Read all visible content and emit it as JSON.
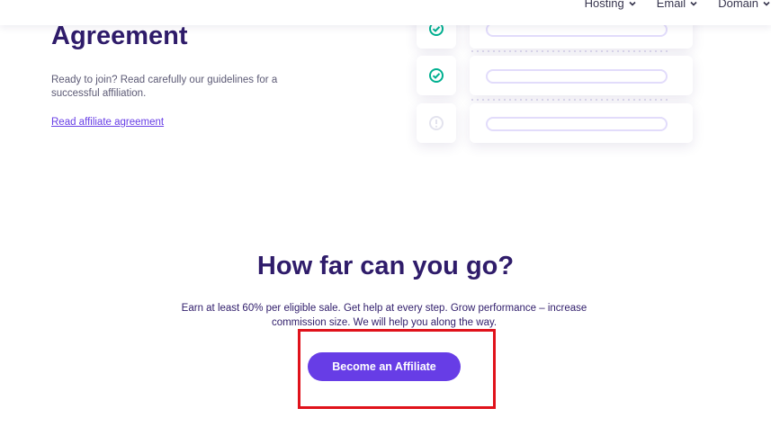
{
  "nav": {
    "items": [
      {
        "label": "Hosting",
        "icon": "chevron-down-icon"
      },
      {
        "label": "Email",
        "icon": "chevron-down-icon"
      },
      {
        "label": "Domain",
        "icon": "chevron-down-icon"
      }
    ]
  },
  "agreement": {
    "title": "Agreement",
    "description": "Ready to join? Read carefully our guidelines for a successful affiliation.",
    "link_label": "Read affiliate agreement"
  },
  "illustration": {
    "rows": [
      {
        "icon": "check-circle-icon",
        "color": "#00b090"
      },
      {
        "icon": "check-circle-icon",
        "color": "#00b090"
      },
      {
        "icon": "warning-circle-icon",
        "color": "#e3e3ee"
      }
    ]
  },
  "growth": {
    "heading": "How far can you go?",
    "text": "Earn at least 60% per eligible sale. Get help at every step. Grow performance – increase commission size. We will help you along the way.",
    "button_label": "Become an Affiliate"
  },
  "colors": {
    "brand": "#673de6",
    "heading": "#2f1c6a",
    "highlight": "#e0121b"
  }
}
